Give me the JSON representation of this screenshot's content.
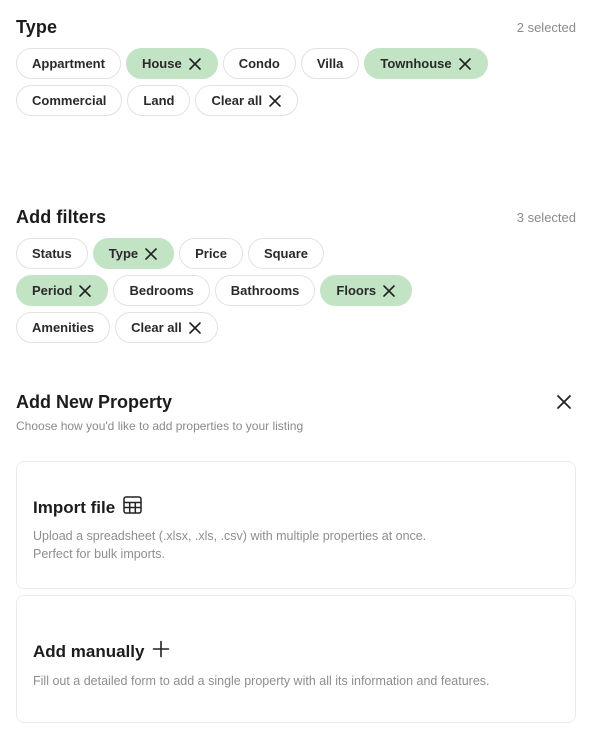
{
  "type_section": {
    "title": "Type",
    "count": "2 selected",
    "chips": [
      {
        "label": "Appartment",
        "selected": false
      },
      {
        "label": "House",
        "selected": true
      },
      {
        "label": "Condo",
        "selected": false
      },
      {
        "label": "Villa",
        "selected": false
      },
      {
        "label": "Townhouse",
        "selected": true
      },
      {
        "label": "Commercial",
        "selected": false
      },
      {
        "label": "Land",
        "selected": false
      }
    ],
    "clear_label": "Clear all"
  },
  "filters_section": {
    "title": "Add filters",
    "count": "3 selected",
    "chips": [
      {
        "label": "Status",
        "selected": false
      },
      {
        "label": "Type",
        "selected": true
      },
      {
        "label": "Price",
        "selected": false
      },
      {
        "label": "Square",
        "selected": false
      },
      {
        "label": "Period",
        "selected": true
      },
      {
        "label": "Bedrooms",
        "selected": false
      },
      {
        "label": "Bathrooms",
        "selected": false
      },
      {
        "label": "Floors",
        "selected": true
      },
      {
        "label": "Amenities",
        "selected": false
      }
    ],
    "clear_label": "Clear all"
  },
  "add_property": {
    "title": "Add New Property",
    "subtitle": "Choose how you'd like to add properties to your listing",
    "close_icon": "close-icon",
    "import_card": {
      "title": "Import file",
      "icon": "table-icon",
      "desc_line1": "Upload a spreadsheet (.xlsx, .xls, .csv) with multiple properties at once.",
      "desc_line2": "Perfect for bulk imports."
    },
    "manual_card": {
      "title": "Add manually",
      "icon": "plus-icon",
      "desc": "Fill out a detailed form to add a single property with all its information and features."
    }
  },
  "colors": {
    "selected_chip_bg": "#c3e3c5",
    "chip_border": "#e2e2e2",
    "muted_text": "#8a8a8a"
  }
}
